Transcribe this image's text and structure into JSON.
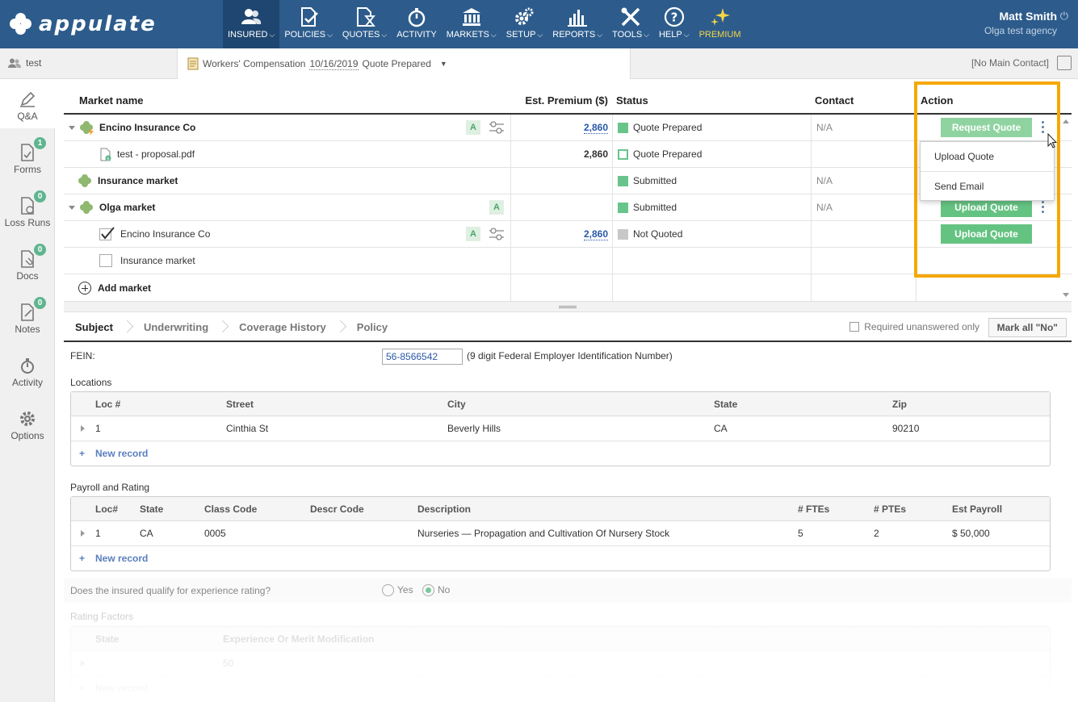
{
  "app": {
    "logo_text": "appulate"
  },
  "nav": {
    "items": [
      {
        "label": "INSURED",
        "icon": "users-icon",
        "has_menu": true
      },
      {
        "label": "POLICIES",
        "icon": "document-check-icon",
        "has_menu": true
      },
      {
        "label": "QUOTES",
        "icon": "document-hourglass-icon",
        "has_menu": true
      },
      {
        "label": "ACTIVITY",
        "icon": "stopwatch-icon",
        "has_menu": false
      },
      {
        "label": "MARKETS",
        "icon": "bank-icon",
        "has_menu": true
      },
      {
        "label": "SETUP",
        "icon": "gears-icon",
        "has_menu": true
      },
      {
        "label": "REPORTS",
        "icon": "bar-chart-icon",
        "has_menu": true
      },
      {
        "label": "TOOLS",
        "icon": "wrench-screwdriver-icon",
        "has_menu": true
      },
      {
        "label": "HELP",
        "icon": "question-circle-icon",
        "has_menu": true
      },
      {
        "label": "PREMIUM",
        "icon": "sparkle-icon",
        "has_menu": false
      }
    ],
    "chevron": "⌵"
  },
  "user": {
    "name": "Matt Smith",
    "agency": "Olga test agency",
    "power_glyph": "⏻"
  },
  "subbar": {
    "client_name": "test",
    "policy_type": "Workers' Compensation",
    "policy_date": "10/16/2019",
    "policy_status": "Quote Prepared",
    "main_contact": "[No Main Contact]"
  },
  "sidebar": {
    "items": [
      {
        "label": "Q&A",
        "icon": "pen-icon",
        "badge": null
      },
      {
        "label": "Forms",
        "icon": "forms-icon",
        "badge": "1"
      },
      {
        "label": "Loss Runs",
        "icon": "loss-runs-icon",
        "badge": "0"
      },
      {
        "label": "Docs",
        "icon": "docs-icon",
        "badge": "0"
      },
      {
        "label": "Notes",
        "icon": "notes-icon",
        "badge": "0"
      },
      {
        "label": "Activity",
        "icon": "activity-icon",
        "badge": null
      },
      {
        "label": "Options",
        "icon": "gear-icon",
        "badge": null
      }
    ]
  },
  "markets": {
    "headers": {
      "name": "Market name",
      "premium": "Est. Premium ($)",
      "status": "Status",
      "contact": "Contact",
      "action": "Action"
    },
    "rows": [
      {
        "name": "Encino Insurance Co",
        "premium": "2,860",
        "status": "Quote Prepared",
        "contact": "N/A",
        "action": "Request Quote"
      },
      {
        "name": "test - proposal.pdf",
        "premium": "2,860",
        "status": "Quote Prepared",
        "contact": "",
        "action": ""
      },
      {
        "name": "Insurance market",
        "premium": "",
        "status": "Submitted",
        "contact": "N/A",
        "action": ""
      },
      {
        "name": "Olga market",
        "premium": "",
        "status": "Submitted",
        "contact": "N/A",
        "action": "Upload Quote"
      },
      {
        "name": "Encino Insurance Co",
        "premium": "2,860",
        "status": "Not Quoted",
        "contact": "",
        "action": "Upload Quote"
      },
      {
        "name": "Insurance market",
        "premium": "",
        "status": "",
        "contact": "",
        "action": ""
      }
    ],
    "add_market": "Add market",
    "a_badge": "A",
    "dropdown": [
      "Upload Quote",
      "Send Email"
    ]
  },
  "tabs": {
    "items": [
      "Subject",
      "Underwriting",
      "Coverage History",
      "Policy"
    ],
    "required_only": "Required unanswered only",
    "mark_all_no": "Mark all \"No\""
  },
  "subject": {
    "fein_label": "FEIN:",
    "fein_value": "56-8566542",
    "fein_hint": "(9 digit Federal Employer Identification Number)",
    "locations_title": "Locations",
    "locations_headers": [
      "Loc #",
      "Street",
      "City",
      "State",
      "Zip"
    ],
    "locations_rows": [
      [
        "1",
        "Cinthia St",
        "Beverly Hills",
        "CA",
        "90210"
      ]
    ],
    "new_record": "New record",
    "payroll_title": "Payroll and Rating",
    "payroll_headers": [
      "Loc#",
      "State",
      "Class Code",
      "Descr Code",
      "Description",
      "# FTEs",
      "# PTEs",
      "Est Payroll"
    ],
    "payroll_rows": [
      [
        "1",
        "CA",
        "0005",
        "",
        "Nurseries — Propagation and Cultivation Of Nursery Stock",
        "5",
        "2",
        "$ 50,000"
      ]
    ],
    "experience_question": "Does the insured qualify for experience rating?",
    "yes": "Yes",
    "no": "No",
    "rating_title": "Rating Factors",
    "rating_headers": [
      "State",
      "Experience Or Merit Modification"
    ],
    "rating_value": "50"
  },
  "colors": {
    "brand": "#2d5c8c",
    "accent_green": "#65c382",
    "highlight": "#f5a800",
    "premium": "#f5d547"
  }
}
